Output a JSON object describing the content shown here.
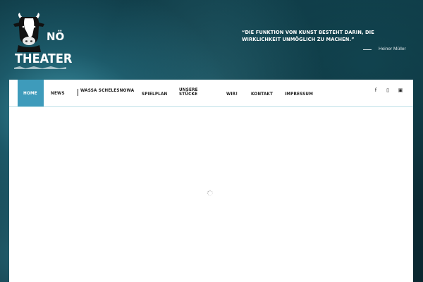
{
  "logo": {
    "line1": "NÖ",
    "line2": "THEATER"
  },
  "quote": {
    "text": "“DIE FUNKTION VON KUNST BESTEHT DARIN, DIE WIRKLICHKEIT UNMÖGLICH ZU MACHEN.”",
    "author": "Heiner Müller"
  },
  "nav": {
    "items": [
      {
        "label": "HOME",
        "active": true
      },
      {
        "label": "NEWS"
      },
      {
        "label": "WASSA SCHELESNOWA"
      },
      {
        "label": "SPIELPLAN"
      },
      {
        "label": "UNSERE STÜCKE"
      },
      {
        "label": "WIR!"
      },
      {
        "label": "KONTAKT"
      },
      {
        "label": "IMPRESSUM"
      }
    ],
    "social": [
      {
        "icon": "facebook-icon",
        "glyph": "f"
      },
      {
        "icon": "instagram-icon",
        "glyph": "▯"
      },
      {
        "icon": "youtube-icon",
        "glyph": "▣"
      }
    ]
  },
  "colors": {
    "accent": "#3e9bbb",
    "background": "#0d2f38",
    "content": "#ffffff"
  }
}
